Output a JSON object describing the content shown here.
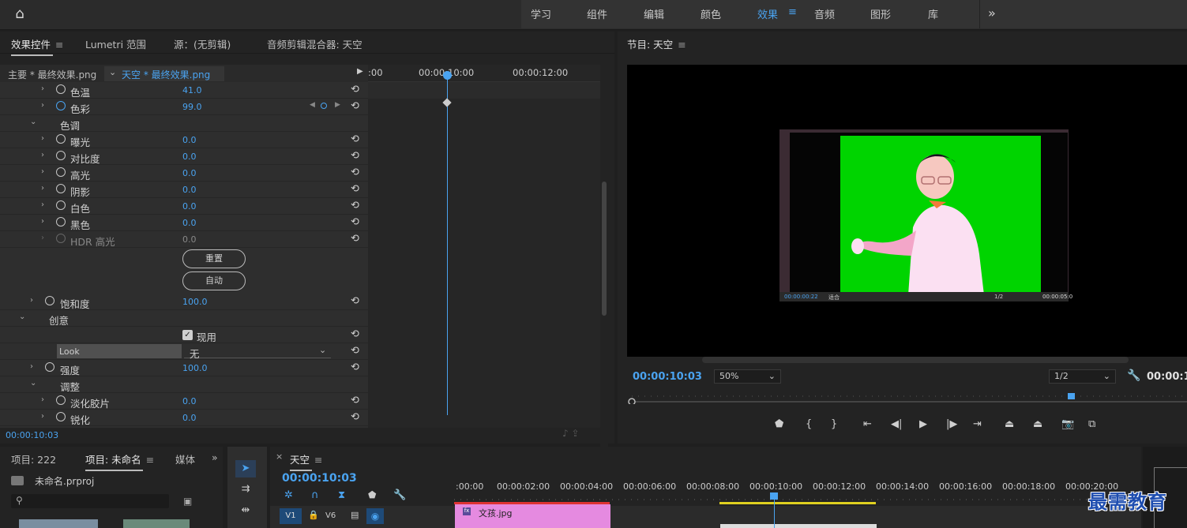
{
  "workspaces": {
    "items": [
      "学习",
      "组件",
      "编辑",
      "颜色",
      "效果",
      "音频",
      "图形",
      "库"
    ],
    "active": "效果",
    "more": "»"
  },
  "effect_controls": {
    "tabs": [
      "效果控件",
      "Lumetri 范围",
      "源：(无剪辑)",
      "音频剪辑混合器: 天空"
    ],
    "source_main": "主要 * 最终效果.png",
    "source_clip": "天空 * 最终效果.png",
    "ruler_labels": [
      ":00",
      "00:00:10:00",
      "00:00:12:00"
    ],
    "rows": [
      {
        "name": "色温",
        "value": "41.0"
      },
      {
        "name": "色彩",
        "value": "99.0"
      },
      {
        "name": "色调",
        "value": ""
      },
      {
        "name": "曝光",
        "value": "0.0"
      },
      {
        "name": "对比度",
        "value": "0.0"
      },
      {
        "name": "高光",
        "value": "0.0"
      },
      {
        "name": "阴影",
        "value": "0.0"
      },
      {
        "name": "白色",
        "value": "0.0"
      },
      {
        "name": "黑色",
        "value": "0.0"
      },
      {
        "name": "HDR 高光",
        "value": "0.0"
      }
    ],
    "reset_label": "重置",
    "auto_label": "自动",
    "saturation": {
      "name": "饱和度",
      "value": "100.0"
    },
    "creative": "创意",
    "apply_label": "现用",
    "look_label": "Look",
    "look_value": "无",
    "intensity": {
      "name": "强度",
      "value": "100.0"
    },
    "adjust": "调整",
    "faded_film": {
      "name": "淡化胶片",
      "value": "0.0"
    },
    "sharpen": {
      "name": "锐化",
      "value": "0.0"
    },
    "current_time": "00:00:10:03"
  },
  "program_monitor": {
    "title": "节目: 天空",
    "timecode": "00:00:10:03",
    "zoom": "50%",
    "resolution": "1/2",
    "duration": "00:00:1",
    "inner_preview": {
      "time": "00:00:00:22",
      "fit": "适合",
      "res": "1/2",
      "dur": "00:00:05:0"
    }
  },
  "project": {
    "tabs": [
      "项目: 222",
      "项目: 未命名",
      "媒体"
    ],
    "file": "未命名.prproj"
  },
  "sequence": {
    "title": "天空",
    "timecode": "00:00:10:03",
    "ruler_labels": [
      ":00:00",
      "00:00:02:00",
      "00:00:04:00",
      "00:00:06:00",
      "00:00:08:00",
      "00:00:10:00",
      "00:00:12:00",
      "00:00:14:00",
      "00:00:16:00",
      "00:00:18:00",
      "00:00:20:00"
    ],
    "tracks": [
      "V1",
      "V6"
    ],
    "clip": "文孩.jpg"
  },
  "watermark": "最需教育",
  "colors": {
    "accent": "#4aa3f0",
    "clip": "#e58ae0",
    "green": "#00d400"
  }
}
